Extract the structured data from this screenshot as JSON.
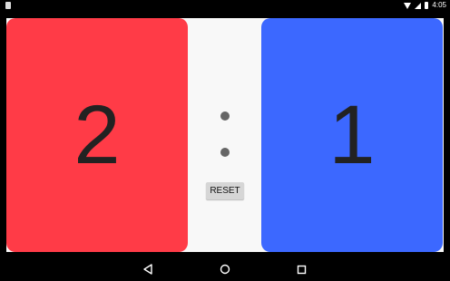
{
  "status_bar": {
    "time": "4:05",
    "icons": [
      "notification-icon",
      "wifi-icon",
      "signal-icon",
      "battery-icon"
    ]
  },
  "scoreboard": {
    "left": {
      "score": "2",
      "color": "#ff3b47"
    },
    "right": {
      "score": "1",
      "color": "#3c68ff"
    },
    "separator_color": "#666666",
    "reset_label": "RESET"
  },
  "nav_bar": {
    "buttons": [
      "back-icon",
      "home-icon",
      "recents-icon"
    ]
  }
}
